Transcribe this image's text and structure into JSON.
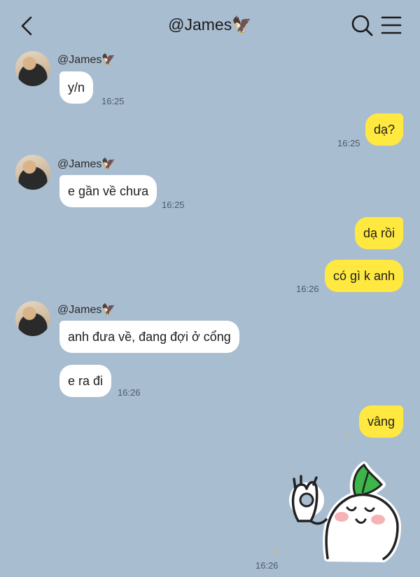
{
  "header": {
    "title": "@James🦅",
    "back_icon": "chevron-left-icon",
    "search_icon": "search-icon",
    "menu_icon": "menu-icon"
  },
  "messages": {
    "m1": {
      "sender": "@James🦅",
      "text": "y/n",
      "time": "16:25"
    },
    "m2": {
      "text": "dạ?",
      "time": "16:25"
    },
    "m3": {
      "sender": "@James🦅",
      "text": "e gần về chưa",
      "time": "16:25"
    },
    "m4": {
      "text": "dạ rồi"
    },
    "m5": {
      "text": "có gì k anh",
      "time": "16:26"
    },
    "m6": {
      "sender": "@James🦅",
      "text": "anh đưa về, đang đợi ở cổng"
    },
    "m7": {
      "text": "e ra đi",
      "time": "16:26"
    },
    "m8": {
      "text": "vâng",
      "read": "1"
    },
    "m9": {
      "sticker": "radish-ok-sticker",
      "read": "1",
      "time": "16:26"
    }
  },
  "colors": {
    "background": "#a9bdd1",
    "incoming_bubble": "#ffffff",
    "outgoing_bubble": "#ffe941"
  }
}
